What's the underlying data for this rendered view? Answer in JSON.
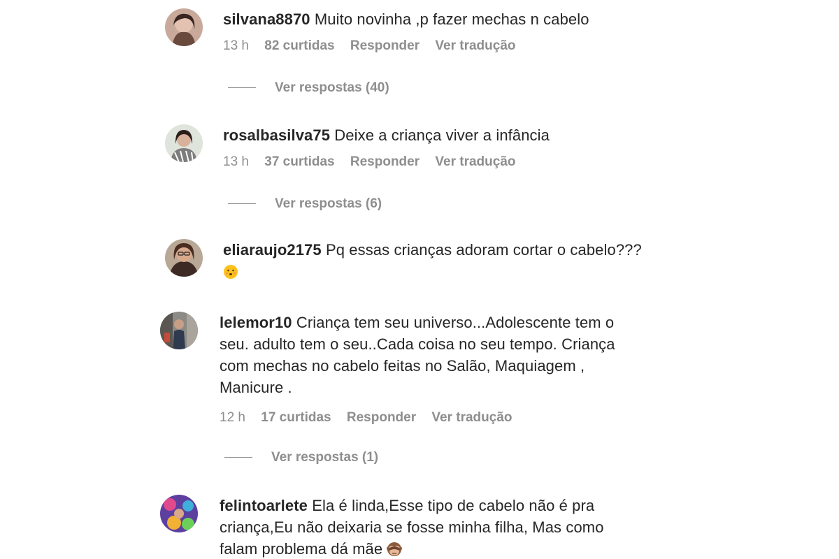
{
  "comments": [
    {
      "username": "silvana8870",
      "text": "Muito novinha ,p fazer mechas n cabelo",
      "time": "13 h",
      "likes": "82 curtidas",
      "reply": "Responder",
      "translate": "Ver tradução",
      "view_replies": "Ver respostas (40)"
    },
    {
      "username": "rosalbasilva75",
      "text": "Deixe a criança viver a infância",
      "time": "13 h",
      "likes": "37 curtidas",
      "reply": "Responder",
      "translate": "Ver tradução",
      "view_replies": "Ver respostas (6)"
    },
    {
      "username": "eliaraujo2175",
      "text": "Pq essas crianças adoram cortar o cabelo???",
      "emoji": "hushed-face-emoji"
    },
    {
      "username": "lelemor10",
      "text_line1": "Criança tem seu universo...Adolescente tem o",
      "text_line2": "seu. adulto tem o seu..Cada coisa no seu tempo. Criança",
      "text_line3": "com mechas no cabelo feitas no Salão, Maquiagem ,",
      "text_line4": "Manicure .",
      "time": "12 h",
      "likes": "17 curtidas",
      "reply": "Responder",
      "translate": "Ver tradução",
      "view_replies": "Ver respostas (1)"
    },
    {
      "username": "felintoarlete",
      "text_line1": "Ela é linda,Esse tipo de cabelo não é pra",
      "text_line2": "criança,Eu não deixaria se fosse minha filha, Mas como",
      "text_line3": "falam problema dá mãe",
      "emoji": "see-no-evil-monkey-emoji"
    }
  ],
  "colors": {
    "text": "#262626",
    "secondary": "#8e8e8e",
    "background": "#ffffff"
  }
}
